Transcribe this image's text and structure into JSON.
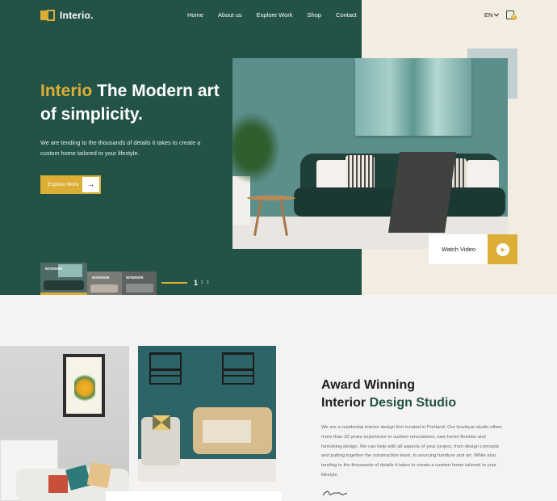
{
  "brand": {
    "name": "Interio."
  },
  "nav": {
    "items": [
      "Home",
      "About us",
      "Explore Work",
      "Shop",
      "Contact"
    ]
  },
  "header": {
    "language": "EN",
    "cart_count": "0"
  },
  "hero": {
    "title_accent": "Interio",
    "title_rest": " The Modern art of simplicity.",
    "description": "We are tending to the thousands of details it takes to create a custom home tailored to your lifestyle.",
    "cta_label": "Explore More",
    "watch_label": "Watch Video",
    "slides": [
      {
        "label": "INTERIOR"
      },
      {
        "label": "INTERIOR"
      },
      {
        "label": "INTERIOR"
      }
    ],
    "pager": {
      "current": "1",
      "others": [
        "2",
        "3"
      ]
    }
  },
  "about": {
    "title_line1": "Award Winning",
    "title_line2_plain": "Interior ",
    "title_line2_accent": "Design Studio",
    "description": "We are a residential interior design firm located in Portland. Our boutique studio offers more than 20 years experience in custom renovations, new home finishes and furnishing design. We can help with all aspects of your project, from design concepts and putting together the construction team, to sourcing furniture and art. While also tending to the thousands of details it takes to create a custom home tailored to your lifestyle."
  },
  "colors": {
    "primary_green": "#235347",
    "accent_gold": "#dcae36",
    "cream": "#f3ece0"
  }
}
